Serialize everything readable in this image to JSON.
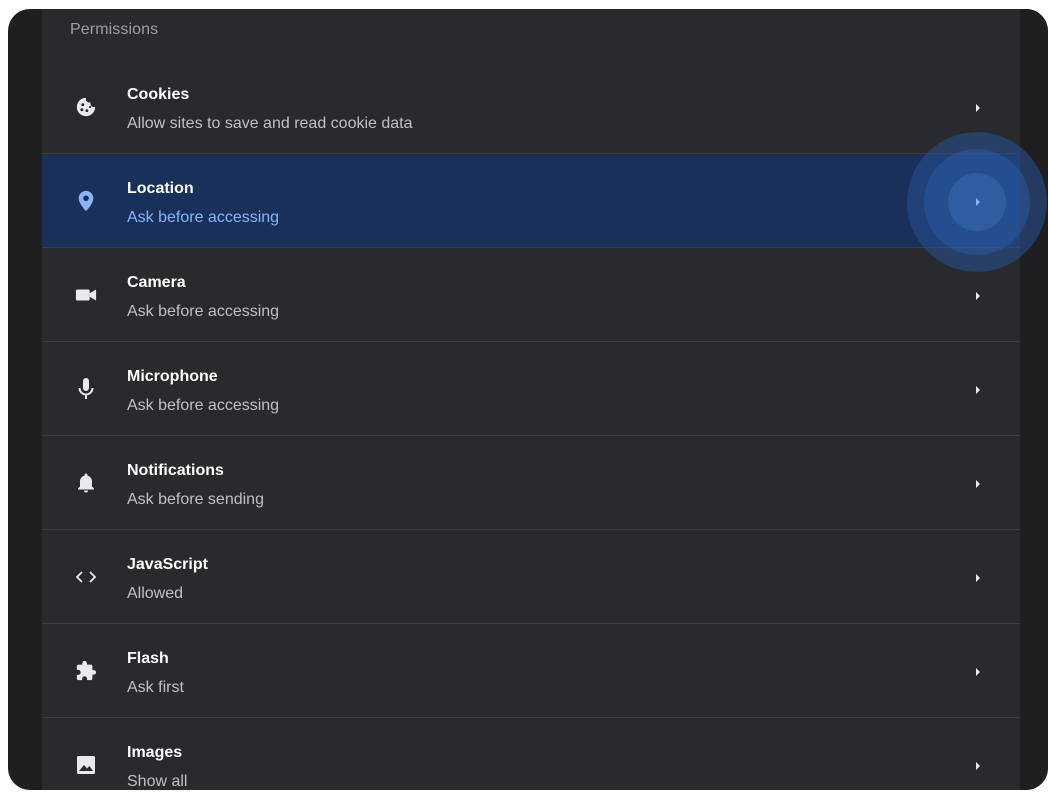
{
  "section": {
    "title": "Permissions"
  },
  "rows": [
    {
      "title": "Cookies",
      "subtitle": "Allow sites to save and read cookie data",
      "icon": "cookie-icon"
    },
    {
      "title": "Location",
      "subtitle": "Ask before accessing",
      "icon": "location-pin-icon",
      "selected": true
    },
    {
      "title": "Camera",
      "subtitle": "Ask before accessing",
      "icon": "camera-icon"
    },
    {
      "title": "Microphone",
      "subtitle": "Ask before accessing",
      "icon": "microphone-icon"
    },
    {
      "title": "Notifications",
      "subtitle": "Ask before sending",
      "icon": "bell-icon"
    },
    {
      "title": "JavaScript",
      "subtitle": "Allowed",
      "icon": "code-icon"
    },
    {
      "title": "Flash",
      "subtitle": "Ask first",
      "icon": "puzzle-icon"
    },
    {
      "title": "Images",
      "subtitle": "Show all",
      "icon": "image-icon"
    }
  ],
  "colors": {
    "background": "#292a2d",
    "selected_row": "#18305a",
    "accent": "#8ab4f8",
    "title_text": "#ffffff",
    "subtitle_text": "#bdc1c6"
  }
}
